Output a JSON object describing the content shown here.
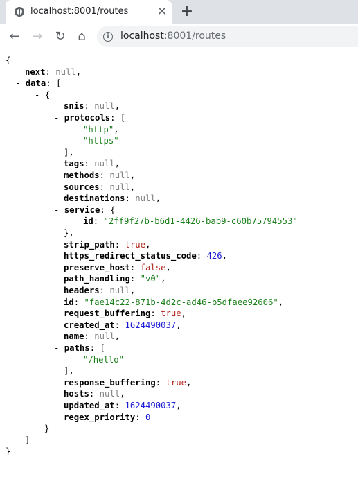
{
  "browser": {
    "tab_title": "localhost:8001/routes",
    "tab_close_glyph": "✕",
    "new_tab_glyph": "+",
    "url_host": "localhost",
    "url_path": ":8001/routes",
    "back_glyph": "←",
    "forward_glyph": "→",
    "reload_glyph": "↻",
    "home_glyph": "⌂",
    "info_glyph": "i"
  },
  "json_view": {
    "colors": {
      "null": "#808080",
      "string": "#1a7f1a",
      "number": "#1c1cd4",
      "boolean": "#b3261e"
    },
    "lines": [
      {
        "indent": 0,
        "text": "{"
      },
      {
        "indent": 1,
        "key": "next",
        "value": "null",
        "vtype": "null",
        "comma": true
      },
      {
        "indent": 1,
        "toggle": "- ",
        "key": "data",
        "open": "["
      },
      {
        "indent": 2,
        "toggle": "- ",
        "text": "{"
      },
      {
        "indent": 3,
        "key": "snis",
        "value": "null",
        "vtype": "null",
        "comma": true
      },
      {
        "indent": 3,
        "toggle": "- ",
        "key": "protocols",
        "open": "["
      },
      {
        "indent": 4,
        "value": "\"http\"",
        "vtype": "str",
        "comma": true
      },
      {
        "indent": 4,
        "value": "\"https\"",
        "vtype": "str"
      },
      {
        "indent": 3,
        "text": "]",
        "comma": true
      },
      {
        "indent": 3,
        "key": "tags",
        "value": "null",
        "vtype": "null",
        "comma": true
      },
      {
        "indent": 3,
        "key": "methods",
        "value": "null",
        "vtype": "null",
        "comma": true
      },
      {
        "indent": 3,
        "key": "sources",
        "value": "null",
        "vtype": "null",
        "comma": true
      },
      {
        "indent": 3,
        "key": "destinations",
        "value": "null",
        "vtype": "null",
        "comma": true
      },
      {
        "indent": 3,
        "toggle": "- ",
        "key": "service",
        "open": "{"
      },
      {
        "indent": 4,
        "key": "id",
        "value": "\"2ff9f27b-b6d1-4426-bab9-c60b75794553\"",
        "vtype": "str"
      },
      {
        "indent": 3,
        "text": "}",
        "comma": true
      },
      {
        "indent": 3,
        "key": "strip_path",
        "value": "true",
        "vtype": "bool",
        "comma": true
      },
      {
        "indent": 3,
        "key": "https_redirect_status_code",
        "value": "426",
        "vtype": "num",
        "comma": true
      },
      {
        "indent": 3,
        "key": "preserve_host",
        "value": "false",
        "vtype": "bool",
        "comma": true
      },
      {
        "indent": 3,
        "key": "path_handling",
        "value": "\"v0\"",
        "vtype": "str",
        "comma": true
      },
      {
        "indent": 3,
        "key": "headers",
        "value": "null",
        "vtype": "null",
        "comma": true
      },
      {
        "indent": 3,
        "key": "id",
        "value": "\"fae14c22-871b-4d2c-ad46-b5dfaee92606\"",
        "vtype": "str",
        "comma": true
      },
      {
        "indent": 3,
        "key": "request_buffering",
        "value": "true",
        "vtype": "bool",
        "comma": true
      },
      {
        "indent": 3,
        "key": "created_at",
        "value": "1624490037",
        "vtype": "num",
        "comma": true
      },
      {
        "indent": 3,
        "key": "name",
        "value": "null",
        "vtype": "null",
        "comma": true
      },
      {
        "indent": 3,
        "toggle": "- ",
        "key": "paths",
        "open": "["
      },
      {
        "indent": 4,
        "value": "\"/hello\"",
        "vtype": "str"
      },
      {
        "indent": 3,
        "text": "]",
        "comma": true
      },
      {
        "indent": 3,
        "key": "response_buffering",
        "value": "true",
        "vtype": "bool",
        "comma": true
      },
      {
        "indent": 3,
        "key": "hosts",
        "value": "null",
        "vtype": "null",
        "comma": true
      },
      {
        "indent": 3,
        "key": "updated_at",
        "value": "1624490037",
        "vtype": "num",
        "comma": true
      },
      {
        "indent": 3,
        "key": "regex_priority",
        "value": "0",
        "vtype": "num"
      },
      {
        "indent": 2,
        "text": "}"
      },
      {
        "indent": 1,
        "text": "]"
      },
      {
        "indent": 0,
        "text": "}"
      }
    ]
  }
}
